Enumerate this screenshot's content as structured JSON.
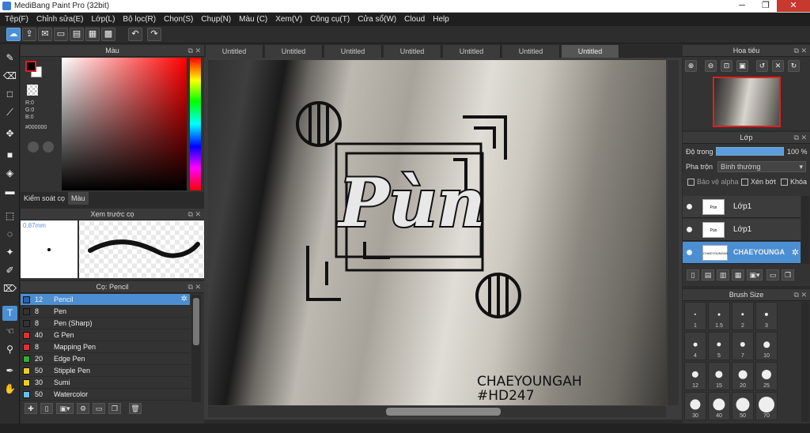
{
  "window": {
    "title": "MediBang Paint Pro (32bit)",
    "min": "─",
    "max": "❐",
    "close": "✕"
  },
  "menu": [
    "Tệp(F)",
    "Chỉnh sửa(E)",
    "Lớp(L)",
    "Bộ lọc(R)",
    "Chọn(S)",
    "Chụp(N)",
    "Màu (C)",
    "Xem(V)",
    "Công cụ(T)",
    "Cửa sổ(W)",
    "Cloud",
    "Help"
  ],
  "color_panel": {
    "title": "Màu",
    "r": "R:0",
    "g": "G:0",
    "b": "B:0",
    "hex": "#000000",
    "tabs": [
      "Kiểm soát cọ",
      "Màu"
    ]
  },
  "brush_preview": {
    "title": "Xem trước cọ",
    "size": "0.87mm"
  },
  "brush_list": {
    "title": "Cọ: Pencil",
    "items": [
      {
        "size": "12",
        "name": "Pencil",
        "color": "#2e5ea8"
      },
      {
        "size": "8",
        "name": "Pen",
        "color": "#333333"
      },
      {
        "size": "8",
        "name": "Pen (Sharp)",
        "color": "#333333"
      },
      {
        "size": "40",
        "name": "G Pen",
        "color": "#e03030"
      },
      {
        "size": "8",
        "name": "Mapping Pen",
        "color": "#e03030"
      },
      {
        "size": "20",
        "name": "Edge Pen",
        "color": "#30b030"
      },
      {
        "size": "50",
        "name": "Stipple Pen",
        "color": "#e8d020"
      },
      {
        "size": "30",
        "name": "Sumi",
        "color": "#e8d020"
      },
      {
        "size": "50",
        "name": "Watercolor",
        "color": "#60c0f0"
      }
    ]
  },
  "doc_tabs": [
    "Untitled",
    "Untitled",
    "Untitled",
    "Untitled",
    "Untitled",
    "Untitled",
    "Untitled"
  ],
  "canvas": {
    "logo": "Pùn",
    "credit1": "CHAEYOUNGAH",
    "credit2": "#HD247"
  },
  "navigator": {
    "title": "Hoa tiêu"
  },
  "layers": {
    "title": "Lớp",
    "opacity_label": "Độ trong",
    "opacity_value": "100 %",
    "opacity": 1.0,
    "blend_label": "Pha trộn",
    "blend_value": "Bình thường",
    "protect_alpha": "Bảo vệ alpha",
    "clipping": "Xén bớt",
    "lock": "Khóa",
    "items": [
      {
        "name": "Lớp1",
        "thumb": "Pùn"
      },
      {
        "name": "Lớp1",
        "thumb": "Pùn"
      },
      {
        "name": "CHAEYOUNGA",
        "thumb": "CHAEYOUNGAH"
      }
    ]
  },
  "brush_size": {
    "title": "Brush Size",
    "sizes": [
      "1",
      "1.5",
      "2",
      "3",
      "4",
      "5",
      "7",
      "10",
      "12",
      "15",
      "20",
      "25",
      "30",
      "40",
      "50",
      "70"
    ]
  }
}
